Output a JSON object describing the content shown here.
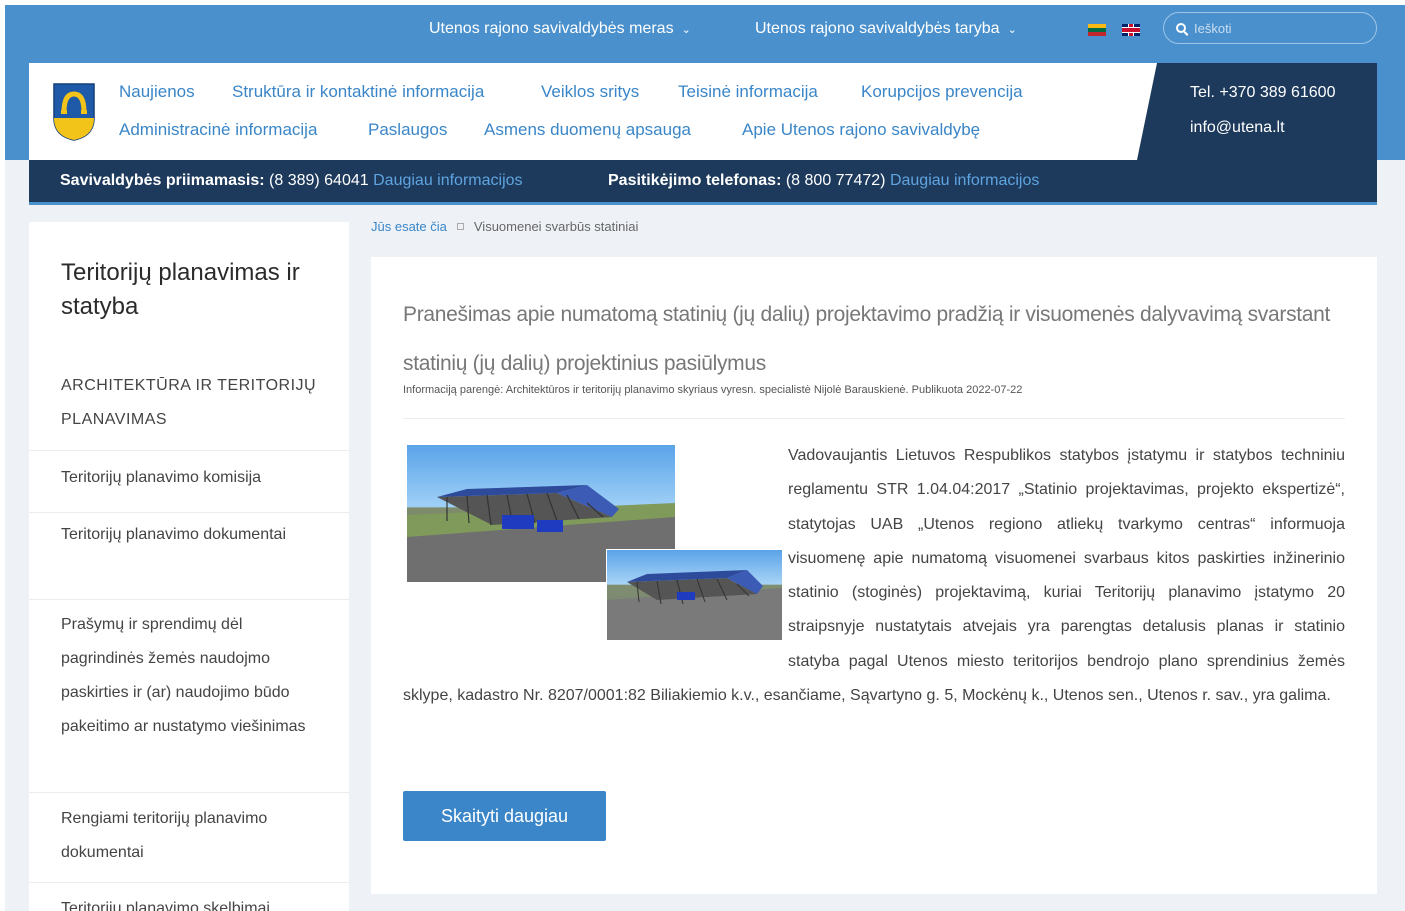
{
  "topnav": {
    "mayor": "Utenos rajono savivaldybės meras",
    "council": "Utenos rajono savivaldybės taryba",
    "search_placeholder": "Ieškoti"
  },
  "mainnav": {
    "items": [
      "Naujienos",
      "Struktūra ir kontaktinė informacija",
      "Veiklos sritys",
      "Teisinė informacija",
      "Korupcijos prevencija",
      "Administracinė informacija",
      "Paslaugos",
      "Asmens duomenų apsauga",
      "Apie Utenos rajono savivaldybę"
    ]
  },
  "contact": {
    "phone": "Tel. +370 389 61600",
    "email": "info@utena.lt"
  },
  "info": {
    "reception_label": "Savivaldybės priimamasis:",
    "reception_number": "(8 389) 64041",
    "reception_link": "Daugiau informacijos",
    "trust_label": "Pasitikėjimo telefonas:",
    "trust_number": "(8 800 77472)",
    "trust_link": "Daugiau informacijos"
  },
  "sidebar": {
    "title": "Teritorijų planavimas ir statyba",
    "items": [
      "ARCHITEKTŪRA IR TERITORIJŲ PLANAVIMAS",
      "Teritorijų planavimo komisija",
      "Teritorijų planavimo dokumentai",
      "Prašymų ir sprendimų dėl pagrindinės žemės naudojmo paskirties ir (ar) naudojimo būdo pakeitimo ar nustatymo viešinimas",
      "Rengiami teritorijų planavimo dokumentai",
      "Teritorijų planavimo skelbimai"
    ]
  },
  "breadcrumb": {
    "root": "Jūs esate čia",
    "current": "Visuomenei svarbūs statiniai"
  },
  "article": {
    "title": "Pranešimas apie numatomą statinių (jų dalių) projektavimo pradžią ir visuomenės dalyvavimą svarstant statinių (jų dalių) projektinius pasiūlymus",
    "meta": "Informaciją parengė: Architektūros ir teritorijų planavimo skyriaus vyresn. specialistė Nijolė Barauskienė. Publikuota 2022-07-22",
    "body": "Vadovaujantis Lietuvos Respublikos statybos įstatymu ir statybos techniniu reglamentu STR 1.04.04:2017 „Statinio projektavimas, projekto ekspertizė“, statytojas UAB „Utenos regiono atliekų tvarkymo centras“ informuoja visuomenę apie numatomą visuomenei svarbaus kitos paskirties inžinerinio statinio (stoginės) projektavimą, kuriai Teritorijų planavimo įstatymo 20 straipsnyje nustatytais atvejais yra parengtas detalusis planas ir statinio statyba pagal Utenos miesto teritorijos bendrojo plano sprendinius žemės sklype, kadastro Nr. 8207/0001:82 Biliakiemio k.v., esančiame, Sąvartyno g. 5, Mockėnų k., Utenos sen., Utenos r. sav., yra galima.",
    "read_more": "Skaityti daugiau"
  },
  "colors": {
    "top_blue": "#4a90cc",
    "dark_navy": "#1d3a5c",
    "link_blue": "#3a86c8"
  }
}
